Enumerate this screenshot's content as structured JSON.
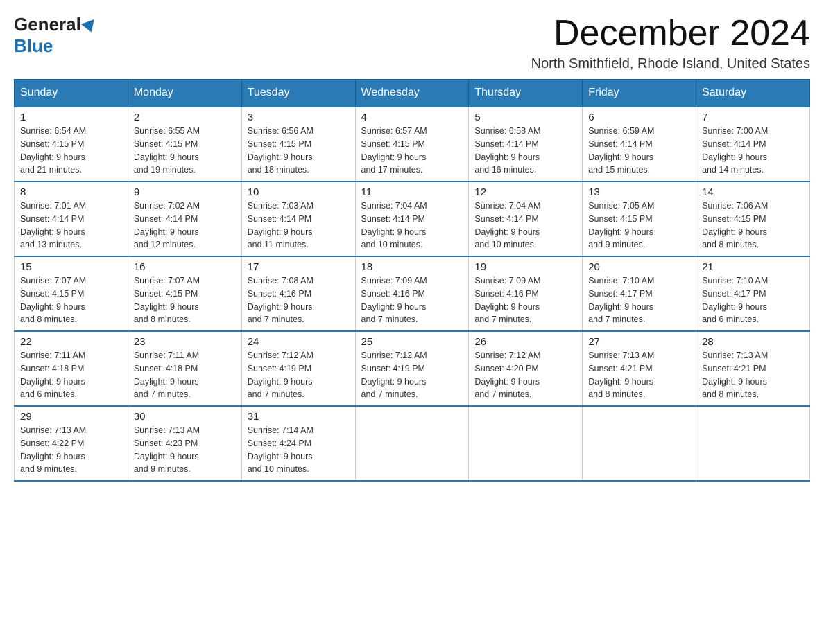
{
  "logo": {
    "general": "General",
    "blue": "Blue"
  },
  "title": {
    "month": "December 2024",
    "location": "North Smithfield, Rhode Island, United States"
  },
  "weekdays": [
    "Sunday",
    "Monday",
    "Tuesday",
    "Wednesday",
    "Thursday",
    "Friday",
    "Saturday"
  ],
  "weeks": [
    [
      {
        "day": "1",
        "sunrise": "6:54 AM",
        "sunset": "4:15 PM",
        "daylight": "9 hours and 21 minutes."
      },
      {
        "day": "2",
        "sunrise": "6:55 AM",
        "sunset": "4:15 PM",
        "daylight": "9 hours and 19 minutes."
      },
      {
        "day": "3",
        "sunrise": "6:56 AM",
        "sunset": "4:15 PM",
        "daylight": "9 hours and 18 minutes."
      },
      {
        "day": "4",
        "sunrise": "6:57 AM",
        "sunset": "4:15 PM",
        "daylight": "9 hours and 17 minutes."
      },
      {
        "day": "5",
        "sunrise": "6:58 AM",
        "sunset": "4:14 PM",
        "daylight": "9 hours and 16 minutes."
      },
      {
        "day": "6",
        "sunrise": "6:59 AM",
        "sunset": "4:14 PM",
        "daylight": "9 hours and 15 minutes."
      },
      {
        "day": "7",
        "sunrise": "7:00 AM",
        "sunset": "4:14 PM",
        "daylight": "9 hours and 14 minutes."
      }
    ],
    [
      {
        "day": "8",
        "sunrise": "7:01 AM",
        "sunset": "4:14 PM",
        "daylight": "9 hours and 13 minutes."
      },
      {
        "day": "9",
        "sunrise": "7:02 AM",
        "sunset": "4:14 PM",
        "daylight": "9 hours and 12 minutes."
      },
      {
        "day": "10",
        "sunrise": "7:03 AM",
        "sunset": "4:14 PM",
        "daylight": "9 hours and 11 minutes."
      },
      {
        "day": "11",
        "sunrise": "7:04 AM",
        "sunset": "4:14 PM",
        "daylight": "9 hours and 10 minutes."
      },
      {
        "day": "12",
        "sunrise": "7:04 AM",
        "sunset": "4:14 PM",
        "daylight": "9 hours and 10 minutes."
      },
      {
        "day": "13",
        "sunrise": "7:05 AM",
        "sunset": "4:15 PM",
        "daylight": "9 hours and 9 minutes."
      },
      {
        "day": "14",
        "sunrise": "7:06 AM",
        "sunset": "4:15 PM",
        "daylight": "9 hours and 8 minutes."
      }
    ],
    [
      {
        "day": "15",
        "sunrise": "7:07 AM",
        "sunset": "4:15 PM",
        "daylight": "9 hours and 8 minutes."
      },
      {
        "day": "16",
        "sunrise": "7:07 AM",
        "sunset": "4:15 PM",
        "daylight": "9 hours and 8 minutes."
      },
      {
        "day": "17",
        "sunrise": "7:08 AM",
        "sunset": "4:16 PM",
        "daylight": "9 hours and 7 minutes."
      },
      {
        "day": "18",
        "sunrise": "7:09 AM",
        "sunset": "4:16 PM",
        "daylight": "9 hours and 7 minutes."
      },
      {
        "day": "19",
        "sunrise": "7:09 AM",
        "sunset": "4:16 PM",
        "daylight": "9 hours and 7 minutes."
      },
      {
        "day": "20",
        "sunrise": "7:10 AM",
        "sunset": "4:17 PM",
        "daylight": "9 hours and 7 minutes."
      },
      {
        "day": "21",
        "sunrise": "7:10 AM",
        "sunset": "4:17 PM",
        "daylight": "9 hours and 6 minutes."
      }
    ],
    [
      {
        "day": "22",
        "sunrise": "7:11 AM",
        "sunset": "4:18 PM",
        "daylight": "9 hours and 6 minutes."
      },
      {
        "day": "23",
        "sunrise": "7:11 AM",
        "sunset": "4:18 PM",
        "daylight": "9 hours and 7 minutes."
      },
      {
        "day": "24",
        "sunrise": "7:12 AM",
        "sunset": "4:19 PM",
        "daylight": "9 hours and 7 minutes."
      },
      {
        "day": "25",
        "sunrise": "7:12 AM",
        "sunset": "4:19 PM",
        "daylight": "9 hours and 7 minutes."
      },
      {
        "day": "26",
        "sunrise": "7:12 AM",
        "sunset": "4:20 PM",
        "daylight": "9 hours and 7 minutes."
      },
      {
        "day": "27",
        "sunrise": "7:13 AM",
        "sunset": "4:21 PM",
        "daylight": "9 hours and 8 minutes."
      },
      {
        "day": "28",
        "sunrise": "7:13 AM",
        "sunset": "4:21 PM",
        "daylight": "9 hours and 8 minutes."
      }
    ],
    [
      {
        "day": "29",
        "sunrise": "7:13 AM",
        "sunset": "4:22 PM",
        "daylight": "9 hours and 9 minutes."
      },
      {
        "day": "30",
        "sunrise": "7:13 AM",
        "sunset": "4:23 PM",
        "daylight": "9 hours and 9 minutes."
      },
      {
        "day": "31",
        "sunrise": "7:14 AM",
        "sunset": "4:24 PM",
        "daylight": "9 hours and 10 minutes."
      },
      null,
      null,
      null,
      null
    ]
  ],
  "labels": {
    "sunrise": "Sunrise:",
    "sunset": "Sunset:",
    "daylight": "Daylight:"
  }
}
